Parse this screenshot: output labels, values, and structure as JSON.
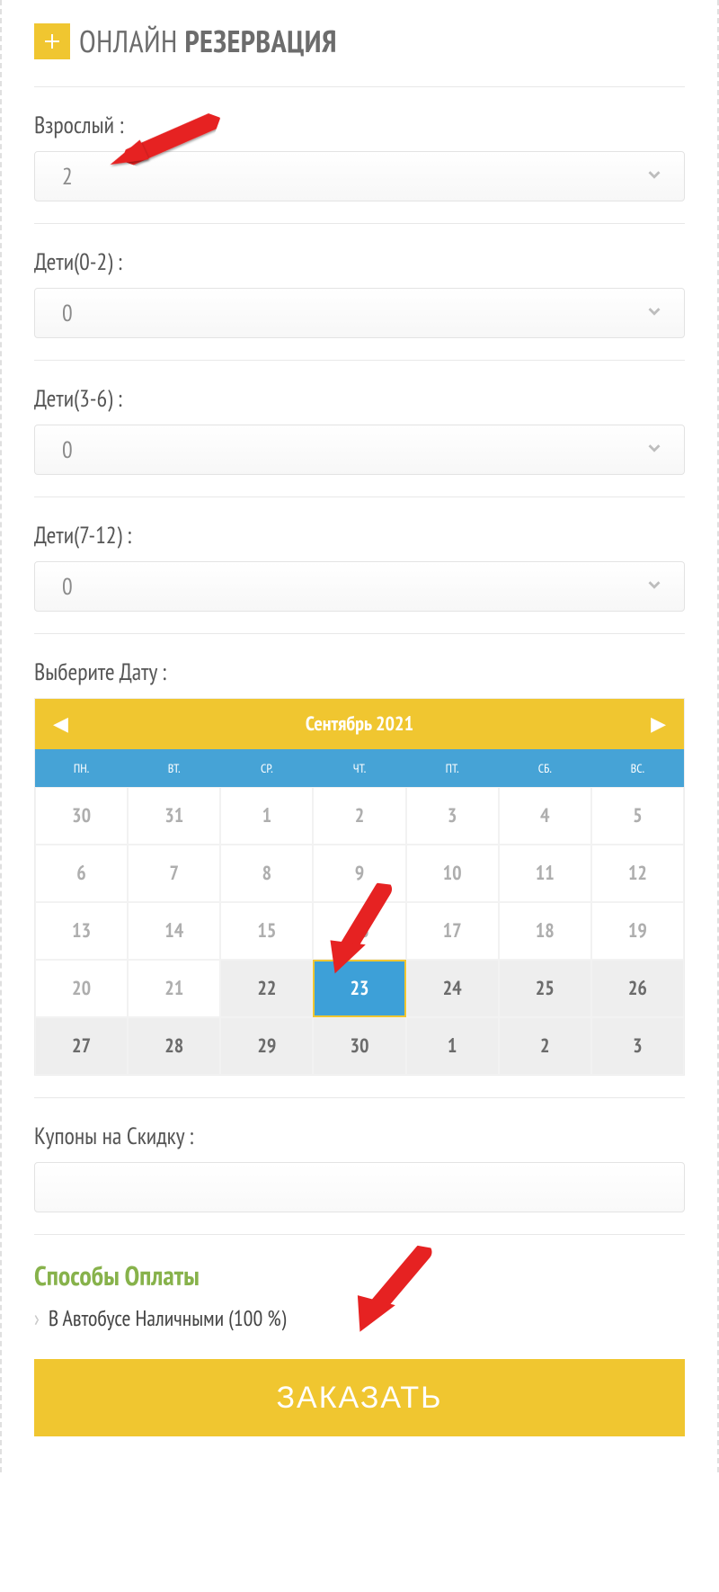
{
  "header": {
    "title_light": "ОНЛАЙН ",
    "title_bold": "РЕЗЕРВАЦИЯ"
  },
  "fields": {
    "adult": {
      "label": "Взрослый :",
      "value": "2"
    },
    "child02": {
      "label": "Дети(0-2) :",
      "value": "0"
    },
    "child36": {
      "label": "Дети(3-6) :",
      "value": "0"
    },
    "child712": {
      "label": "Дети(7-12) :",
      "value": "0"
    },
    "date": {
      "label": "Выберите Дату :"
    },
    "coupon": {
      "label": "Купоны на Скидку :",
      "value": ""
    }
  },
  "calendar": {
    "title": "Сентябрь 2021",
    "days": [
      "ПН.",
      "ВТ.",
      "СР.",
      "ЧТ.",
      "ПТ.",
      "СБ.",
      "ВС."
    ],
    "cells": [
      {
        "n": "30",
        "t": "past"
      },
      {
        "n": "31",
        "t": "past"
      },
      {
        "n": "1",
        "t": "past"
      },
      {
        "n": "2",
        "t": "past"
      },
      {
        "n": "3",
        "t": "past"
      },
      {
        "n": "4",
        "t": "past"
      },
      {
        "n": "5",
        "t": "past"
      },
      {
        "n": "6",
        "t": "past"
      },
      {
        "n": "7",
        "t": "past"
      },
      {
        "n": "8",
        "t": "past"
      },
      {
        "n": "9",
        "t": "past"
      },
      {
        "n": "10",
        "t": "past"
      },
      {
        "n": "11",
        "t": "past"
      },
      {
        "n": "12",
        "t": "past"
      },
      {
        "n": "13",
        "t": "past"
      },
      {
        "n": "14",
        "t": "past"
      },
      {
        "n": "15",
        "t": "past"
      },
      {
        "n": "16",
        "t": "past"
      },
      {
        "n": "17",
        "t": "past"
      },
      {
        "n": "18",
        "t": "past"
      },
      {
        "n": "19",
        "t": "past"
      },
      {
        "n": "20",
        "t": "past"
      },
      {
        "n": "21",
        "t": "past"
      },
      {
        "n": "22",
        "t": "avail"
      },
      {
        "n": "23",
        "t": "sel"
      },
      {
        "n": "24",
        "t": "avail"
      },
      {
        "n": "25",
        "t": "avail"
      },
      {
        "n": "26",
        "t": "avail"
      },
      {
        "n": "27",
        "t": "avail"
      },
      {
        "n": "28",
        "t": "avail"
      },
      {
        "n": "29",
        "t": "avail"
      },
      {
        "n": "30",
        "t": "avail"
      },
      {
        "n": "1",
        "t": "avail"
      },
      {
        "n": "2",
        "t": "avail"
      },
      {
        "n": "3",
        "t": "avail"
      }
    ]
  },
  "payment": {
    "title": "Способы Оплаты",
    "option": "В Автобусе Наличными (100 %)"
  },
  "submit": {
    "label": "ЗАКАЗАТЬ"
  }
}
